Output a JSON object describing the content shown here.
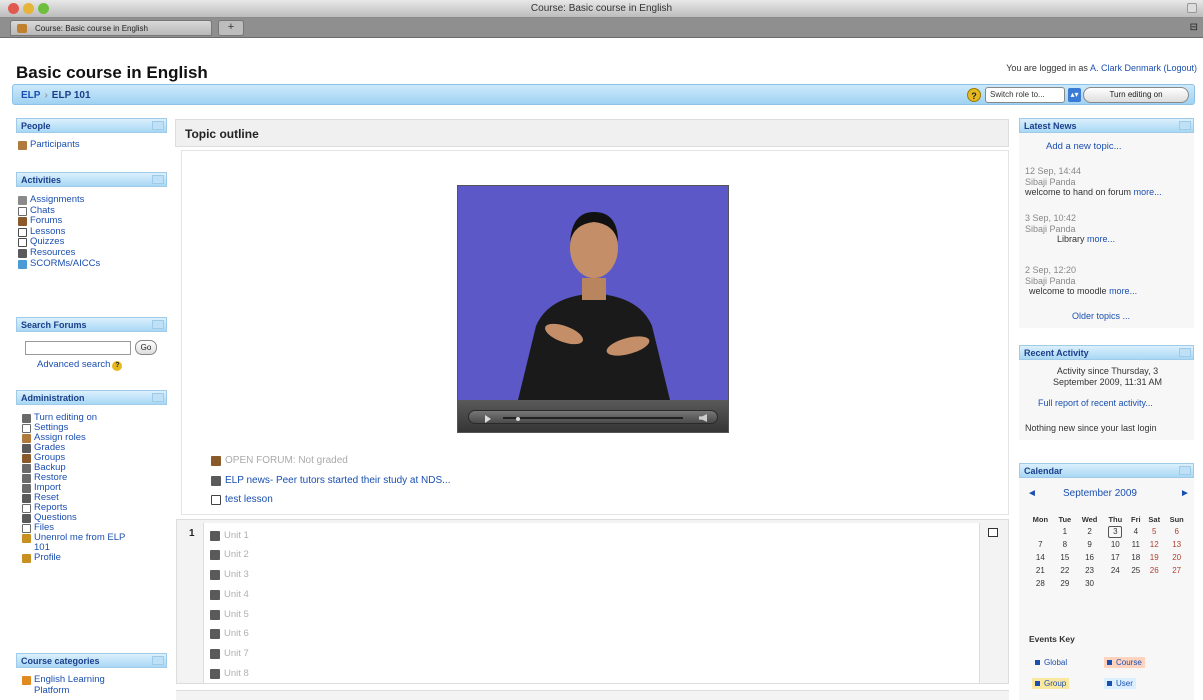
{
  "window": {
    "title": "Course: Basic course in English"
  },
  "tabs": {
    "label": "Course: Basic course in English",
    "add_label": "+"
  },
  "header": {
    "site_title": "Basic course in English",
    "login_prefix": "You are logged in as",
    "user_name": "A. Clark Denmark",
    "logout": "(Logout)"
  },
  "navbar": {
    "crumbs": [
      "ELP",
      "ELP 101"
    ],
    "separator": "›",
    "role_select": "Switch role to...",
    "edit_button": "Turn editing on"
  },
  "blocks": {
    "people": {
      "title": "People",
      "items": [
        "Participants"
      ]
    },
    "activities": {
      "title": "Activities",
      "items": [
        "Assignments",
        "Chats",
        "Forums",
        "Lessons",
        "Quizzes",
        "Resources",
        "SCORMs/AICCs"
      ]
    },
    "search": {
      "title": "Search Forums",
      "go": "Go",
      "advanced": "Advanced search"
    },
    "admin": {
      "title": "Administration",
      "items": [
        "Turn editing on",
        "Settings",
        "Assign roles",
        "Grades",
        "Groups",
        "Backup",
        "Restore",
        "Import",
        "Reset",
        "Reports",
        "Questions",
        "Files",
        "Unenrol me from ELP",
        "101",
        "Profile"
      ]
    },
    "categories": {
      "title": "Course categories",
      "items": [
        "English Learning",
        "Platform"
      ]
    }
  },
  "main": {
    "topic_outline": "Topic outline",
    "section0": {
      "activities": [
        "OPEN FORUM: Not graded",
        "ELP news- Peer tutors started their study at NDS...",
        "test lesson"
      ]
    },
    "section1": {
      "number": "1",
      "units": [
        "Unit 1",
        "Unit 2",
        "Unit 3",
        "Unit 4",
        "Unit 5",
        "Unit 6",
        "Unit 7",
        "Unit 8"
      ]
    }
  },
  "right": {
    "news": {
      "title": "Latest News",
      "add": "Add a new topic...",
      "items": [
        {
          "date": "12 Sep, 14:44",
          "author": "Sibaji Panda",
          "text": "welcome to hand on forum",
          "more": "more..."
        },
        {
          "date": "3 Sep, 10:42",
          "author": "Sibaji Panda",
          "text": "Library",
          "more": "more..."
        },
        {
          "date": "2 Sep, 12:20",
          "author": "Sibaji Panda",
          "text": "welcome to moodle",
          "more": "more..."
        }
      ],
      "older": "Older topics ..."
    },
    "recent": {
      "title": "Recent Activity",
      "line1": "Activity since Thursday, 3",
      "line2": "September 2009, 11:31 AM",
      "report": "Full report of recent activity...",
      "none": "Nothing new since your last login"
    },
    "calendar": {
      "title": "Calendar",
      "prev": "◄",
      "next": "►",
      "month": "September 2009",
      "days": [
        "Mon",
        "Tue",
        "Wed",
        "Thu",
        "Fri",
        "Sat",
        "Sun"
      ],
      "weeks": [
        [
          "",
          "1",
          "2",
          "3",
          "4",
          "5",
          "6"
        ],
        [
          "7",
          "8",
          "9",
          "10",
          "11",
          "12",
          "13"
        ],
        [
          "14",
          "15",
          "16",
          "17",
          "18",
          "19",
          "20"
        ],
        [
          "21",
          "22",
          "23",
          "24",
          "25",
          "26",
          "27"
        ],
        [
          "28",
          "29",
          "30",
          "",
          "",
          "",
          ""
        ]
      ],
      "events_key": "Events Key",
      "keys": [
        "Global",
        "Course",
        "Group",
        "User"
      ]
    }
  },
  "colors": {
    "nav_blue": "#9fd2f2",
    "link": "#1a4fb0",
    "video_bg": "#5c58c8"
  }
}
